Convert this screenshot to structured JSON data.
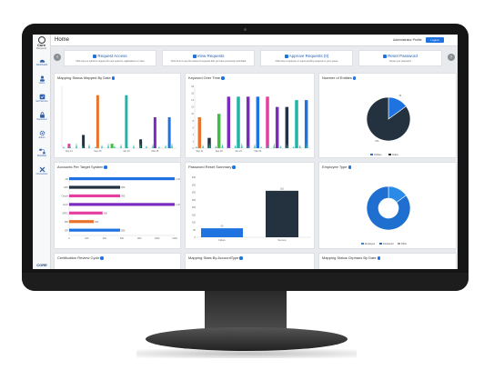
{
  "app": {
    "title": "Home",
    "profile_label": "Administrator Profile",
    "logout_label": "Logout"
  },
  "sidebar": {
    "brand": "Core",
    "brand_sub": "Password",
    "items": [
      {
        "label": "Dashboard"
      },
      {
        "label": "Users"
      },
      {
        "label": "Self Service"
      },
      {
        "label": "Password"
      },
      {
        "label": "Admin"
      },
      {
        "label": "Workflow"
      },
      {
        "label": "Connectors"
      }
    ],
    "footer": "CORE"
  },
  "actions": [
    {
      "label": "Request Access",
      "sub": "Click here to submit a request for new systems, applications or roles"
    },
    {
      "label": "View Requests",
      "sub": "Click here to see the status of requests that you have previously submitted"
    },
    {
      "label": "Approve Requests (0)",
      "sub": "Click here to approve or reject pending requests in your queue"
    },
    {
      "label": "Reset Password",
      "sub": "Reset your password"
    }
  ],
  "panels": {
    "p1": "Mapping Status Mapped By Date",
    "p2": "Keyword Over Time",
    "p3": "Number of Entities",
    "p4": "Accounts Per Target System",
    "p5": "Password Reset Summary",
    "p6": "Employee Type",
    "p7": "Certification Review Cycle",
    "p8": "Mapping Stats By AccountType",
    "p9": "Mapping Status Orphans By Date"
  },
  "colors": {
    "blue": "#1f73e0",
    "dark": "#24323f",
    "orange": "#e8732a",
    "teal": "#1fb5a8",
    "purple": "#7b2bbf",
    "pink": "#e63fa0",
    "green": "#3fbf3f"
  },
  "chart_data": [
    {
      "type": "bar",
      "title": "Mapping Status Mapped By Date",
      "categories": [
        "Sep 11",
        "",
        "Sep 28",
        "",
        "Jan 23",
        "",
        "Mar 25",
        ""
      ],
      "series": [
        {
          "values": [
            1,
            3,
            12,
            1,
            12,
            2,
            7,
            7
          ]
        }
      ],
      "bar_colors": [
        "#e63fa0",
        "#24323f",
        "#e8732a",
        "#3fbf3f",
        "#1fb5a8",
        "#24323f",
        "#7b2bbf",
        "#1f73e0"
      ],
      "ylim": [
        0,
        14
      ]
    },
    {
      "type": "bar",
      "title": "Keyword Over Time",
      "categories": [
        "Sep 11",
        "",
        "Sep 28",
        "",
        "Jan 23",
        "",
        "Mar 25",
        "",
        "",
        "",
        "",
        ""
      ],
      "y_ticks": [
        "18",
        "16",
        "14",
        "12",
        "10",
        "8",
        "6",
        "4",
        "2",
        "0"
      ],
      "series": [
        {
          "values": [
            9,
            3,
            10,
            15,
            15,
            15,
            15,
            15,
            12,
            12,
            14,
            14
          ]
        }
      ],
      "bar_colors": [
        "#e8732a",
        "#24323f",
        "#3fbf3f",
        "#7b2bbf",
        "#1fb5a8",
        "#7b2bbf",
        "#1f73e0",
        "#e63fa0",
        "#7b2bbf",
        "#24323f",
        "#1fb5a8",
        "#1f73e0"
      ],
      "ylim": [
        0,
        18
      ]
    },
    {
      "type": "pie",
      "title": "Number of Entities",
      "series": [
        {
          "values": [
            15,
            85
          ]
        }
      ],
      "slice_colors": [
        "#1f73e0",
        "#24323f"
      ],
      "slice_labels": [
        "49",
        "264"
      ],
      "legend": [
        "Orphan",
        "Active"
      ]
    },
    {
      "type": "bar",
      "orientation": "horizontal",
      "title": "Accounts Per Target System",
      "categories": [
        "AD",
        "SAP",
        "Oracle",
        "Exch",
        "SFDC",
        "WD",
        "ISP"
      ],
      "values": [
        1200,
        580,
        580,
        1200,
        380,
        280,
        580
      ],
      "value_labels": [
        "1,200",
        "580",
        "580",
        "1,200",
        "380",
        "280",
        "580"
      ],
      "bar_colors": [
        "#1f73e0",
        "#24323f",
        "#e63fa0",
        "#7b2bbf",
        "#e63fa0",
        "#e8732a",
        "#1f73e0"
      ],
      "x_ticks": [
        "0",
        "200",
        "400",
        "600",
        "800",
        "1000",
        "1200"
      ],
      "xlim": [
        0,
        1200
      ]
    },
    {
      "type": "bar",
      "title": "Password Reset Summary",
      "categories": [
        "Failure",
        "Success"
      ],
      "values": [
        60,
        310
      ],
      "value_labels": [
        "60",
        "310"
      ],
      "bar_colors": [
        "#1f73e0",
        "#24323f"
      ],
      "y_ticks": [
        "400",
        "350",
        "300",
        "250",
        "200",
        "150",
        "100",
        "50",
        "0"
      ],
      "ylim": [
        0,
        400
      ]
    },
    {
      "type": "pie",
      "title": "Employee Type",
      "series": [
        {
          "values": [
            15,
            85
          ]
        }
      ],
      "slice_colors": [
        "#2a8ae8",
        "#1f6fd0"
      ],
      "legend": [
        "Employee",
        "Contractor",
        "Other"
      ],
      "donut": true
    }
  ]
}
